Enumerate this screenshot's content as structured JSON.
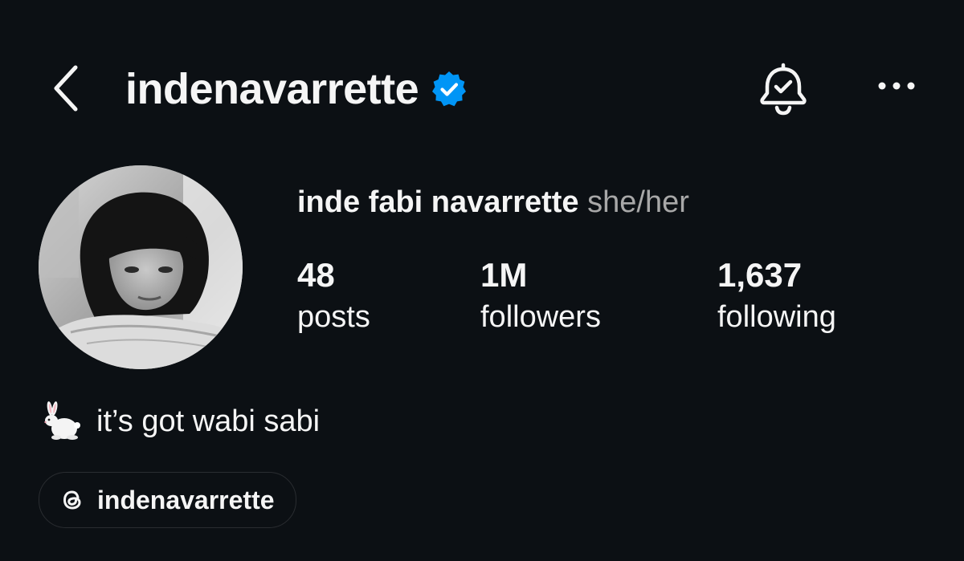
{
  "header": {
    "username": "indenavarrette",
    "verified_icon": "verified-badge-icon",
    "back_icon": "chevron-left-icon",
    "notifications_icon": "bell-check-icon",
    "more_icon": "more-horizontal-icon"
  },
  "profile": {
    "full_name": "inde fabi navarrette",
    "pronouns": "she/her",
    "stats": [
      {
        "value": "48",
        "label": "posts"
      },
      {
        "value": "1M",
        "label": "followers"
      },
      {
        "value": "1,637",
        "label": "following"
      }
    ],
    "bio_emoji": "rabbit-emoji",
    "bio_text": "it’s got wabi sabi",
    "threads_handle": "indenavarrette",
    "threads_icon": "threads-icon"
  },
  "colors": {
    "background": "#0c1014",
    "text": "#f5f5f5",
    "secondary_text": "#a8a8a8",
    "verified_blue": "#0095f6",
    "pill_border": "#2a2d31"
  }
}
